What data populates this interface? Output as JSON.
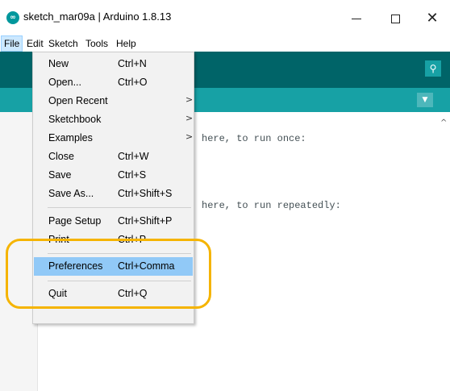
{
  "window": {
    "title": "sketch_mar09a | Arduino 1.8.13",
    "icon": "arduino-logo-icon",
    "controls": {
      "minimize": "minimize-icon",
      "maximize": "maximize-icon",
      "close": "close-icon"
    }
  },
  "menubar": {
    "items": [
      {
        "label": "File",
        "active": true
      },
      {
        "label": "Edit"
      },
      {
        "label": "Sketch"
      },
      {
        "label": "Tools"
      },
      {
        "label": "Help"
      }
    ]
  },
  "toolbar": {
    "serial_monitor_icon": "magnifier-icon"
  },
  "tabbar": {
    "menu_icon": "triangle-down-icon"
  },
  "editor": {
    "lines": [
      "here, to run once:",
      "here, to run repeatedly:"
    ]
  },
  "file_menu": {
    "items": [
      {
        "label": "New",
        "shortcut": "Ctrl+N"
      },
      {
        "label": "Open...",
        "shortcut": "Ctrl+O"
      },
      {
        "label": "Open Recent",
        "shortcut": "",
        "submenu": true
      },
      {
        "label": "Sketchbook",
        "shortcut": "",
        "submenu": true
      },
      {
        "label": "Examples",
        "shortcut": "",
        "submenu": true
      },
      {
        "label": "Close",
        "shortcut": "Ctrl+W"
      },
      {
        "label": "Save",
        "shortcut": "Ctrl+S"
      },
      {
        "label": "Save As...",
        "shortcut": "Ctrl+Shift+S"
      },
      {
        "label": "Page Setup",
        "shortcut": "Ctrl+Shift+P"
      },
      {
        "label": "Print",
        "shortcut": "Ctrl+P"
      },
      {
        "label": "Preferences",
        "shortcut": "Ctrl+Comma",
        "highlighted": true
      },
      {
        "label": "Quit",
        "shortcut": "Ctrl+Q"
      }
    ],
    "submenu_arrow": ">"
  },
  "colors": {
    "toolbar": "#006468",
    "tabbar": "#17a1a5",
    "highlight": "#91c9f7",
    "callout": "#f5b400"
  }
}
